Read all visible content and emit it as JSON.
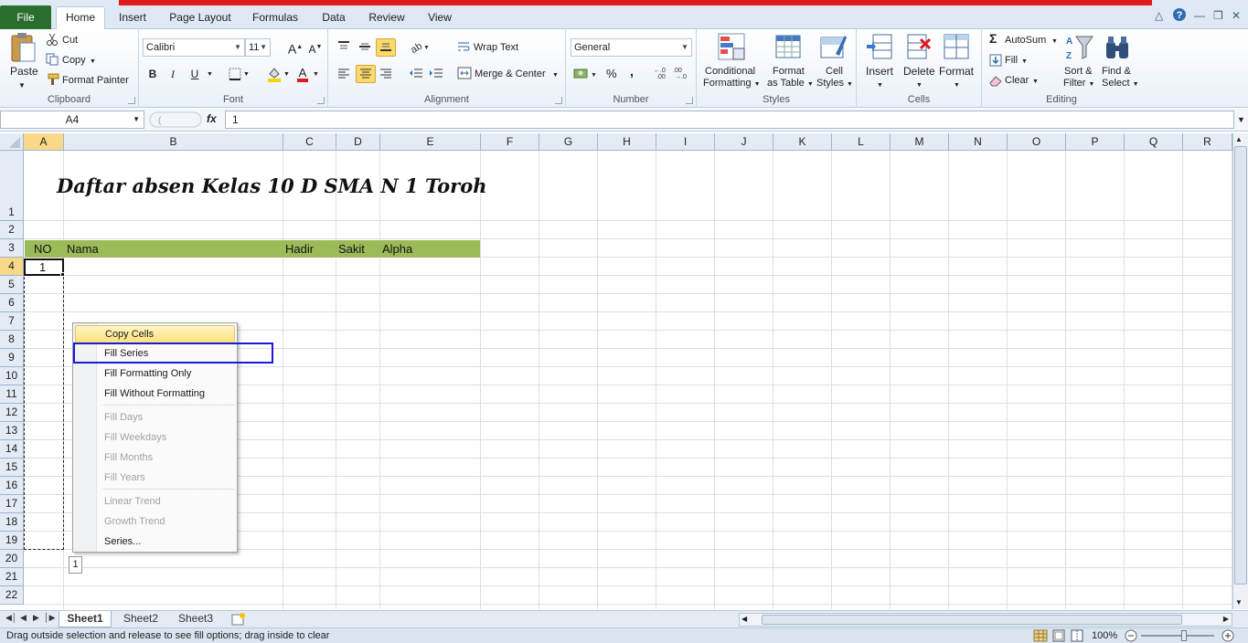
{
  "tabs": {
    "file": "File",
    "items": [
      "Home",
      "Insert",
      "Page Layout",
      "Formulas",
      "Data",
      "Review",
      "View"
    ]
  },
  "ribbon": {
    "clipboard": {
      "label": "Clipboard",
      "paste": "Paste",
      "cut": "Cut",
      "copy": "Copy",
      "format_painter": "Format Painter"
    },
    "font": {
      "label": "Font",
      "family": "Calibri",
      "size": "11",
      "bold": "B",
      "italic": "I",
      "underline": "U"
    },
    "alignment": {
      "label": "Alignment",
      "wrap_text": "Wrap Text",
      "merge_center": "Merge & Center"
    },
    "number": {
      "label": "Number",
      "format": "General",
      "percent": "%",
      "comma": ","
    },
    "styles": {
      "label": "Styles",
      "conditional_1": "Conditional",
      "conditional_2": "Formatting",
      "format_table_1": "Format",
      "format_table_2": "as Table",
      "cell_styles_1": "Cell",
      "cell_styles_2": "Styles"
    },
    "cells": {
      "label": "Cells",
      "insert": "Insert",
      "delete": "Delete",
      "format": "Format"
    },
    "editing": {
      "label": "Editing",
      "autosum": "AutoSum",
      "fill": "Fill",
      "clear": "Clear",
      "sort_1": "Sort &",
      "sort_2": "Filter",
      "find_1": "Find &",
      "find_2": "Select"
    }
  },
  "formula_bar": {
    "name_box": "A4",
    "fx": "fx",
    "value": "1"
  },
  "sheet": {
    "columns": [
      "A",
      "B",
      "C",
      "D",
      "E",
      "F",
      "G",
      "H",
      "I",
      "J",
      "K",
      "L",
      "M",
      "N",
      "O",
      "P",
      "Q",
      "R"
    ],
    "rows": [
      "1",
      "2",
      "3",
      "4",
      "5",
      "6",
      "7",
      "8",
      "9",
      "10",
      "11",
      "12",
      "13",
      "14",
      "15",
      "16",
      "17",
      "18",
      "19",
      "20",
      "21",
      "22"
    ],
    "title": "Daftar absen Kelas 10 D SMA N 1 Toroh",
    "headers": {
      "no": "NO",
      "nama": "Nama",
      "hadir": "Hadir",
      "sakit": "Sakit",
      "alpha": "Alpha"
    },
    "a4_value": "1"
  },
  "colors": {
    "header_band": "#9bbb59",
    "file_tab": "#2a6e2e",
    "highlight_box": "#1a1ad6"
  },
  "context_menu": {
    "items": [
      {
        "label": "Copy Cells",
        "enabled": true
      },
      {
        "label": "Fill Series",
        "enabled": true
      },
      {
        "label": "Fill Formatting Only",
        "enabled": true
      },
      {
        "label": "Fill Without Formatting",
        "enabled": true
      },
      {
        "label": "Fill Days",
        "enabled": false
      },
      {
        "label": "Fill Weekdays",
        "enabled": false
      },
      {
        "label": "Fill Months",
        "enabled": false
      },
      {
        "label": "Fill Years",
        "enabled": false
      },
      {
        "label": "Linear Trend",
        "enabled": false
      },
      {
        "label": "Growth Trend",
        "enabled": false
      },
      {
        "label": "Series...",
        "enabled": true
      }
    ]
  },
  "autofill_icon": "1",
  "sheet_tabs": [
    "Sheet1",
    "Sheet2",
    "Sheet3"
  ],
  "status": {
    "message": "Drag outside selection and release to see fill options; drag inside to clear",
    "zoom": "100%"
  }
}
